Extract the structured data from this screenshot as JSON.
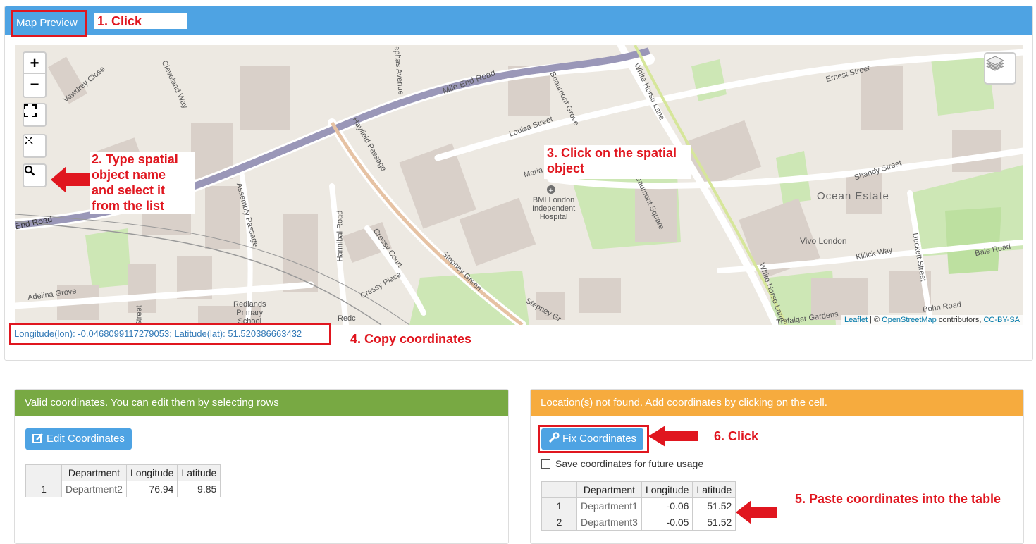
{
  "header": {
    "tab_label": "Map Preview"
  },
  "callouts": {
    "step1": "1. Click",
    "step2": [
      "2. Type spatial",
      "object name",
      "and select it",
      "from the list"
    ],
    "step3": [
      "3. Click on the spatial",
      "object"
    ],
    "step4": "4. Copy coordinates",
    "step5": "5. Paste coordinates into the table",
    "step6": "6. Click"
  },
  "map": {
    "zoom_in": "+",
    "zoom_out": "−",
    "labels": {
      "vawdrey": "Vawdrey Close",
      "cleveland": "Cleveland Way",
      "stephens": "ephas Avenue",
      "mile_end": "Mile End Road",
      "beaumont_grove": "Beaumont Grove",
      "white_horse": "White Horse Lane",
      "ernest": "Ernest Street",
      "louisa": "Louisa Street",
      "hayfield": "Hayfield Passage",
      "maria": "Maria",
      "bmi": [
        "BMI London",
        "Independent",
        "Hospital"
      ],
      "beaumont_sq": "Beaumont Square",
      "shandy": "Shandy Street",
      "ocean": "Ocean Estate",
      "assembly": "Assembly Passage",
      "end_road": "End Road",
      "hannibal": "Hannibal Road",
      "cressy_court": "Cressy Court",
      "cressy_place": "Cressy Place",
      "stepney_green": "Stepney Green",
      "stepney_gr2": "Stepney Gr",
      "vivo": "Vivo London",
      "killick": "Killick Way",
      "bale": "Bale Road",
      "duckett": "Duckett Street",
      "white_horse2": "White Horse Lane",
      "bohn": "Bohn Road",
      "trafalgar": "Trafalgar Gardens",
      "adelina": "Adelina Grove",
      "redlands": [
        "Redlands",
        "Primary",
        "School"
      ],
      "street_left": "Street",
      "redc": "Redc"
    },
    "attribution": {
      "leaflet": "Leaflet",
      "sep": " | © ",
      "osm": "OpenStreetMap",
      "contrib": " contributors, ",
      "license": "CC-BY-SA"
    }
  },
  "coordinates_text": "Longitude(lon): -0.0468099117279053; Latitude(lat): 51.520386663432",
  "valid_panel": {
    "title": "Valid coordinates. You can edit them by selecting rows",
    "button": "Edit Coordinates",
    "columns": [
      "",
      "Department",
      "Longitude",
      "Latitude"
    ],
    "rows": [
      [
        "1",
        "Department2",
        "76.94",
        "9.85"
      ]
    ]
  },
  "notfound_panel": {
    "title": "Location(s) not found. Add coordinates by clicking on the cell.",
    "button": "Fix Coordinates",
    "checkbox_label": "Save coordinates for future usage",
    "columns": [
      "",
      "Department",
      "Longitude",
      "Latitude"
    ],
    "rows": [
      [
        "1",
        "Department1",
        "-0.06",
        "51.52"
      ],
      [
        "2",
        "Department3",
        "-0.05",
        "51.52"
      ]
    ]
  },
  "colors": {
    "primary": "#4ea3e3",
    "green": "#78a943",
    "orange": "#f6ab3e",
    "callout_red": "#e0161f"
  },
  "icons": [
    "zoom-in-icon",
    "zoom-out-icon",
    "fullscreen-icon",
    "reset-view-icon",
    "search-icon",
    "layers-icon",
    "edit-icon",
    "wrench-icon",
    "arrow-left-icon"
  ]
}
